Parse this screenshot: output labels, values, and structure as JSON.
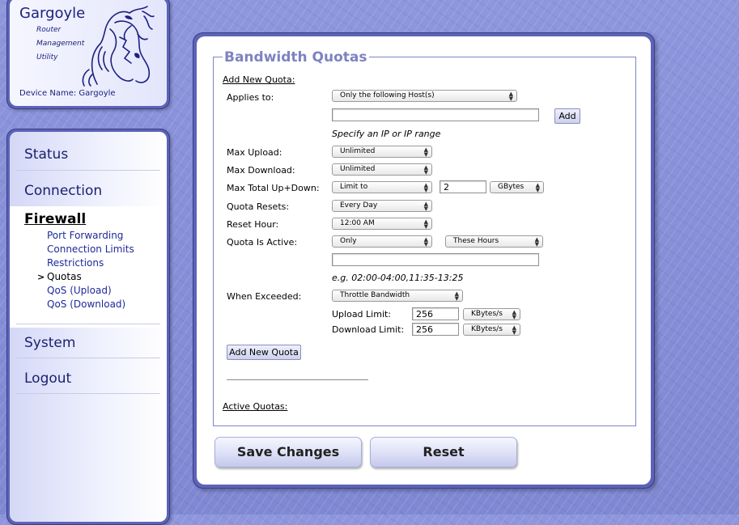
{
  "logo": {
    "title": "Gargoyle",
    "sub1": "Router",
    "sub2": "Management",
    "sub3": "Utility",
    "device_name": "Device Name: Gargoyle"
  },
  "nav": {
    "status": "Status",
    "connection": "Connection",
    "firewall": "Firewall",
    "firewall_items": [
      "Port Forwarding",
      "Connection Limits",
      "Restrictions",
      "Quotas",
      "QoS (Upload)",
      "QoS (Download)"
    ],
    "current_marker": ">",
    "system": "System",
    "logout": "Logout"
  },
  "page": {
    "legend": "Bandwidth Quotas",
    "add_new_quota_heading": "Add New Quota:",
    "applies_to_label": "Applies to:",
    "applies_to_value": "Only the following Host(s)",
    "host_input_value": "",
    "add_button": "Add",
    "host_hint": "Specify an IP or IP range",
    "max_upload_label": "Max Upload:",
    "max_upload_value": "Unlimited",
    "max_download_label": "Max Download:",
    "max_download_value": "Unlimited",
    "max_total_label": "Max Total Up+Down:",
    "max_total_value": "Limit to",
    "max_total_amount": "2",
    "max_total_unit": "GBytes",
    "quota_resets_label": "Quota Resets:",
    "quota_resets_value": "Every Day",
    "reset_hour_label": "Reset Hour:",
    "reset_hour_value": "12:00 AM",
    "quota_active_label": "Quota Is Active:",
    "quota_active_value": "Only",
    "quota_active_period": "These Hours",
    "hours_input_value": "",
    "hours_hint": "e.g. 02:00-04:00,11:35-13:25",
    "when_exceeded_label": "When Exceeded:",
    "when_exceeded_value": "Throttle Bandwidth",
    "upload_limit_label": "Upload Limit:",
    "upload_limit_value": "256",
    "upload_limit_unit": "KBytes/s",
    "download_limit_label": "Download Limit:",
    "download_limit_value": "256",
    "download_limit_unit": "KBytes/s",
    "add_new_quota_button": "Add New Quota",
    "active_quotas_heading": "Active Quotas:",
    "save_button": "Save Changes",
    "reset_button": "Reset"
  },
  "colors": {
    "background": "#8c94d8",
    "frame": "#5c63b8",
    "legend": "#7d83c0",
    "nav_text": "#1a1f6e",
    "sublink": "#1e2a9a"
  }
}
